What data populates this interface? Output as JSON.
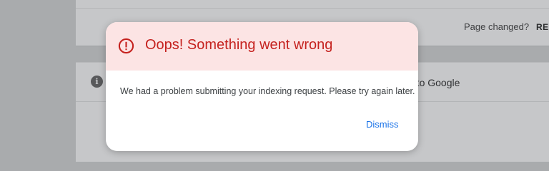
{
  "background": {
    "page_changed_text": "Page changed?",
    "page_changed_action": "REQ",
    "behind_text": "n to Google",
    "info_icon": "info-icon"
  },
  "dialog": {
    "icon": "error-icon",
    "title": "Oops! Something went wrong",
    "message": "We had a problem submitting your indexing request. Please try again later.",
    "dismiss_label": "Dismiss"
  },
  "colors": {
    "header_bg": "#fce4e4",
    "error_red": "#c5221f",
    "link_blue": "#1a73e8",
    "overlay_gray": "#a9abad"
  }
}
